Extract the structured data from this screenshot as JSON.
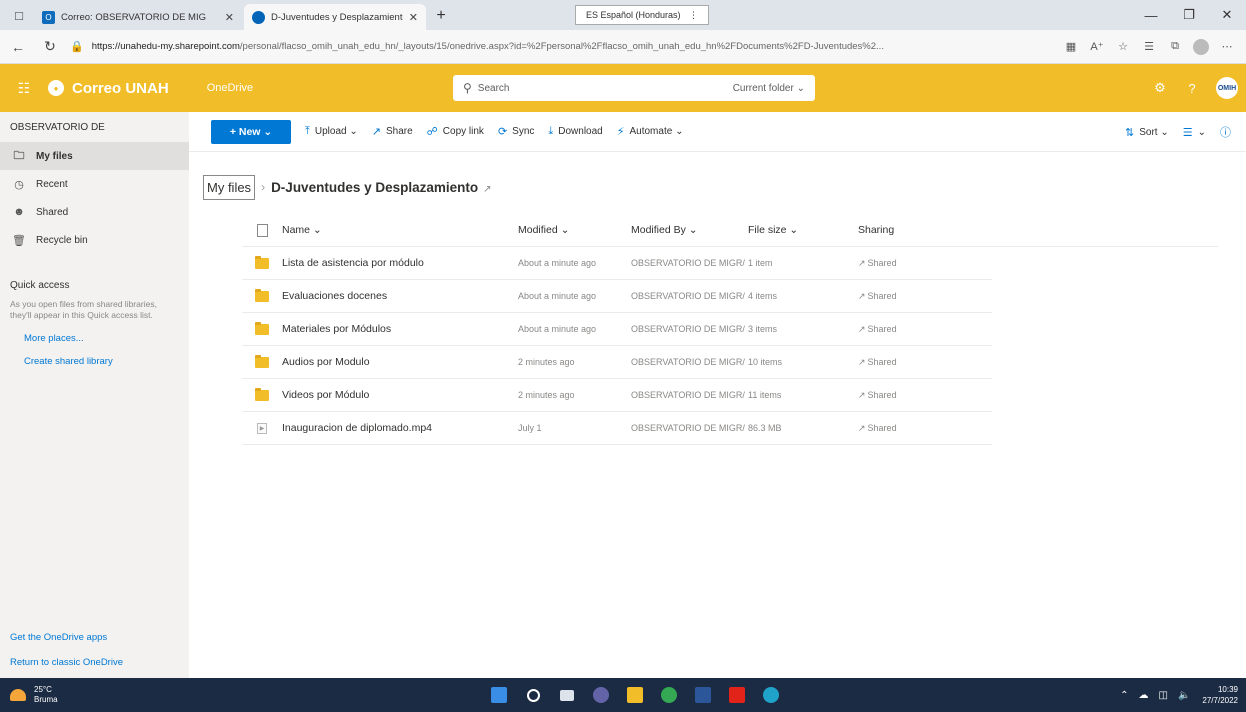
{
  "browser": {
    "tabs": [
      {
        "title": "Correo: OBSERVATORIO DE MIG",
        "favicon": "outlook-icon",
        "active": false
      },
      {
        "title": "D-Juventudes y Desplazamiento",
        "favicon": "onedrive-cloud-icon",
        "active": true
      }
    ],
    "language_pill": "ES Español (Honduras)",
    "url_domain": "https://unahedu-my.sharepoint.com",
    "url_path": "/personal/flacso_omih_unah_edu_hn/_layouts/15/onedrive.aspx?id=%2Fpersonal%2Fflacso_omih_unah_edu_hn%2FDocuments%2FD-Juventudes%2..."
  },
  "suitebar": {
    "brand": "Correo UNAH",
    "app_name": "OneDrive",
    "search_placeholder": "Search",
    "search_scope": "Current folder",
    "user_initials": "OMIH",
    "color": "#f1bd28"
  },
  "leftnav": {
    "header": "OBSERVATORIO DE",
    "items": [
      {
        "label": "My files",
        "icon": "folder-icon",
        "selected": true
      },
      {
        "label": "Recent",
        "icon": "clock-icon",
        "selected": false
      },
      {
        "label": "Shared",
        "icon": "people-icon",
        "selected": false
      },
      {
        "label": "Recycle bin",
        "icon": "trash-icon",
        "selected": false
      }
    ],
    "quick_access_title": "Quick access",
    "quick_access_desc": "As you open files from shared libraries, they'll appear in this Quick access list.",
    "more_places": "More places...",
    "create_library": "Create shared library",
    "get_apps": "Get the OneDrive apps",
    "return_classic": "Return to classic OneDrive"
  },
  "commandbar": {
    "new": "New",
    "upload": "Upload",
    "share": "Share",
    "copy_link": "Copy link",
    "sync": "Sync",
    "download": "Download",
    "automate": "Automate",
    "sort": "Sort"
  },
  "breadcrumb": {
    "root": "My files",
    "current": "D-Juventudes y Desplazamiento"
  },
  "columns": {
    "name": "Name",
    "modified": "Modified",
    "modified_by": "Modified By",
    "file_size": "File size",
    "sharing": "Sharing"
  },
  "files": [
    {
      "name": "Lista de asistencia por módulo",
      "type": "folder",
      "modified": "About a minute ago",
      "modified_by": "OBSERVATORIO DE MIGR/",
      "size": "1 item",
      "sharing": "Shared"
    },
    {
      "name": "Evaluaciones docenes",
      "type": "folder",
      "modified": "About a minute ago",
      "modified_by": "OBSERVATORIO DE MIGR/",
      "size": "4 items",
      "sharing": "Shared"
    },
    {
      "name": "Materiales por Módulos",
      "type": "folder",
      "modified": "About a minute ago",
      "modified_by": "OBSERVATORIO DE MIGR/",
      "size": "3 items",
      "sharing": "Shared"
    },
    {
      "name": "Audios por Modulo",
      "type": "folder",
      "modified": "2 minutes ago",
      "modified_by": "OBSERVATORIO DE MIGR/",
      "size": "10 items",
      "sharing": "Shared"
    },
    {
      "name": "Videos por Módulo",
      "type": "folder",
      "modified": "2 minutes ago",
      "modified_by": "OBSERVATORIO DE MIGR/",
      "size": "11 items",
      "sharing": "Shared"
    },
    {
      "name": "Inauguracion de diplomado.mp4",
      "type": "video",
      "modified": "July 1",
      "modified_by": "OBSERVATORIO DE MIGR/",
      "size": "86.3 MB",
      "sharing": "Shared"
    }
  ],
  "taskbar": {
    "temperature": "25°C",
    "weather": "Bruma",
    "time": "10:39",
    "date": "27/7/2022"
  }
}
